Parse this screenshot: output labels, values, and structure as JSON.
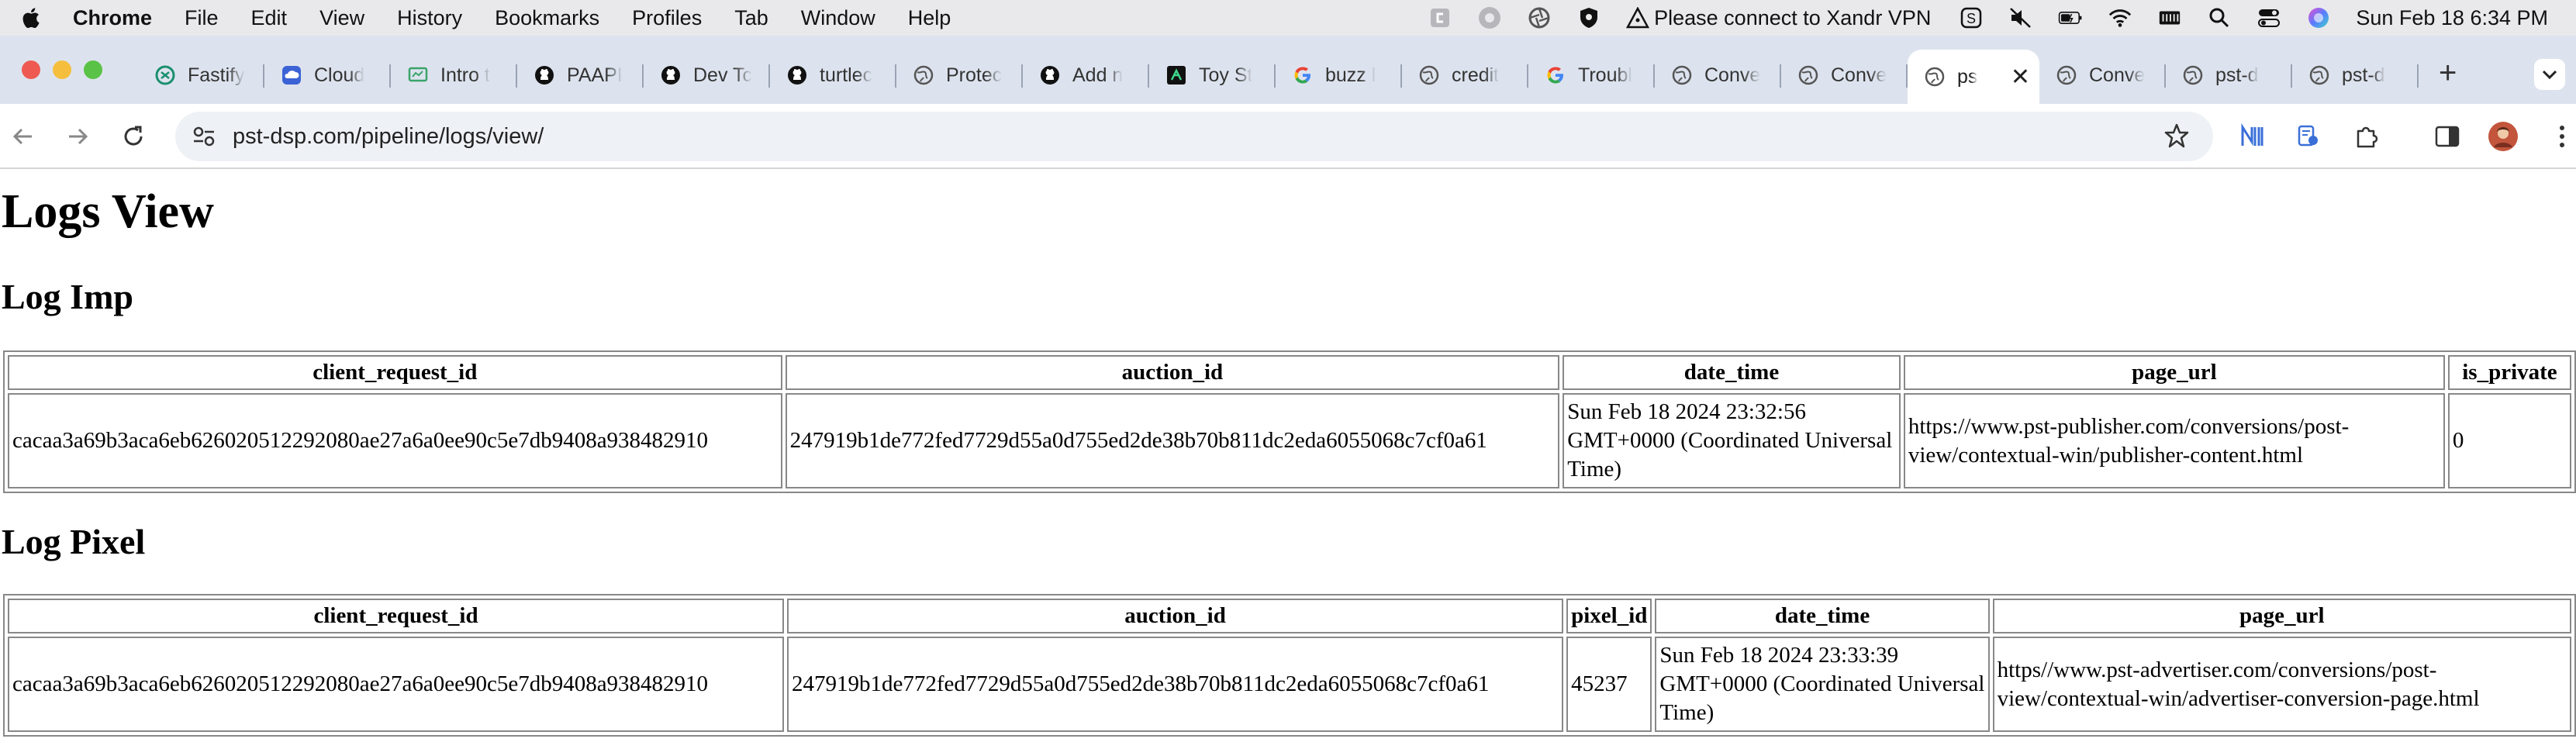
{
  "menubar": {
    "app": "Chrome",
    "items": [
      "File",
      "Edit",
      "View",
      "History",
      "Bookmarks",
      "Profiles",
      "Tab",
      "Window",
      "Help"
    ],
    "vpn_text": "Please connect to Xandr VPN",
    "clock": "Sun Feb 18  6:34 PM"
  },
  "tabs": [
    {
      "label": "Fastify",
      "icon": "openai-icon"
    },
    {
      "label": "Cloud",
      "icon": "cloud-icon"
    },
    {
      "label": "Intro t",
      "icon": "slides-icon"
    },
    {
      "label": "PAAPI",
      "icon": "github-icon"
    },
    {
      "label": "Dev Tc",
      "icon": "github-icon"
    },
    {
      "label": "turtlec",
      "icon": "github-icon"
    },
    {
      "label": "Protec",
      "icon": "globe-icon"
    },
    {
      "label": "Add n",
      "icon": "github-icon"
    },
    {
      "label": "Toy St",
      "icon": "toy-icon"
    },
    {
      "label": "buzz l",
      "icon": "google-icon"
    },
    {
      "label": "credit",
      "icon": "globe-icon"
    },
    {
      "label": "Troubl",
      "icon": "google-icon"
    },
    {
      "label": "Conve",
      "icon": "globe-icon"
    },
    {
      "label": "Conve",
      "icon": "globe-icon"
    },
    {
      "label": "ps",
      "icon": "globe-icon",
      "active": true
    },
    {
      "label": "Conve",
      "icon": "globe-icon"
    },
    {
      "label": "pst-d",
      "icon": "globe-icon"
    },
    {
      "label": "pst-d",
      "icon": "globe-icon"
    }
  ],
  "toolbar": {
    "url": "pst-dsp.com/pipeline/logs/view/"
  },
  "page": {
    "title": "Logs View",
    "imp_heading": "Log Imp",
    "pixel_heading": "Log Pixel",
    "imp_table": {
      "headers": [
        "client_request_id",
        "auction_id",
        "date_time",
        "page_url",
        "is_private"
      ],
      "row": [
        "cacaa3a69b3aca6eb626020512292080ae27a6a0ee90c5e7db9408a938482910",
        "247919b1de772fed7729d55a0d755ed2de38b70b811dc2eda6055068c7cf0a61",
        "Sun Feb 18 2024 23:32:56 GMT+0000 (Coordinated Universal Time)",
        "https://www.pst-publisher.com/conversions/post-view/contextual-win/publisher-content.html",
        "0"
      ]
    },
    "pixel_table": {
      "headers": [
        "client_request_id",
        "auction_id",
        "pixel_id",
        "date_time",
        "page_url"
      ],
      "row": [
        "cacaa3a69b3aca6eb626020512292080ae27a6a0ee90c5e7db9408a938482910",
        "247919b1de772fed7729d55a0d755ed2de38b70b811dc2eda6055068c7cf0a61",
        "45237",
        "Sun Feb 18 2024 23:33:39 GMT+0000 (Coordinated Universal Time)",
        "https//www.pst-advertiser.com/conversions/post-view/contextual-win/advertiser-conversion-page.html"
      ]
    }
  }
}
